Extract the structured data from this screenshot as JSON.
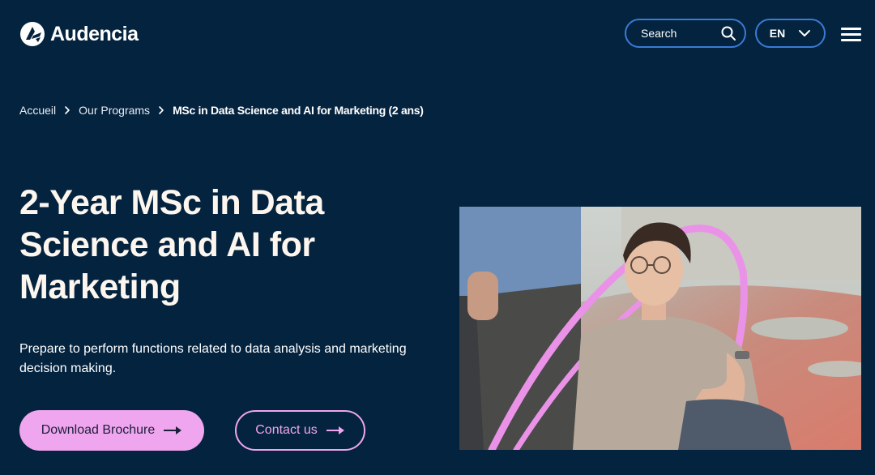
{
  "header": {
    "logo_text": "Audencia",
    "search_label": "Search",
    "language": "EN"
  },
  "breadcrumb": {
    "items": [
      "Accueil",
      "Our Programs"
    ],
    "current": "MSc in Data Science and AI for Marketing (2 ans)"
  },
  "hero": {
    "title_line1": "2-Year MSc in Data",
    "title_line2": "Science and AI for",
    "title_line3": "Marketing",
    "description_line1": "Prepare to perform functions related to data analysis and marketing",
    "description_line2": "decision making.",
    "download_label": "Download Brochure",
    "contact_label": "Contact us"
  },
  "colors": {
    "background": "#04233f",
    "accent_pink": "#f0a6ee",
    "pill_border": "#3a7bd5",
    "title_text": "#fdf6ee"
  },
  "icons": [
    "audencia-logo-icon",
    "search-icon",
    "chevron-down-icon",
    "hamburger-menu-icon",
    "chevron-right-icon",
    "arrow-right-icon"
  ]
}
